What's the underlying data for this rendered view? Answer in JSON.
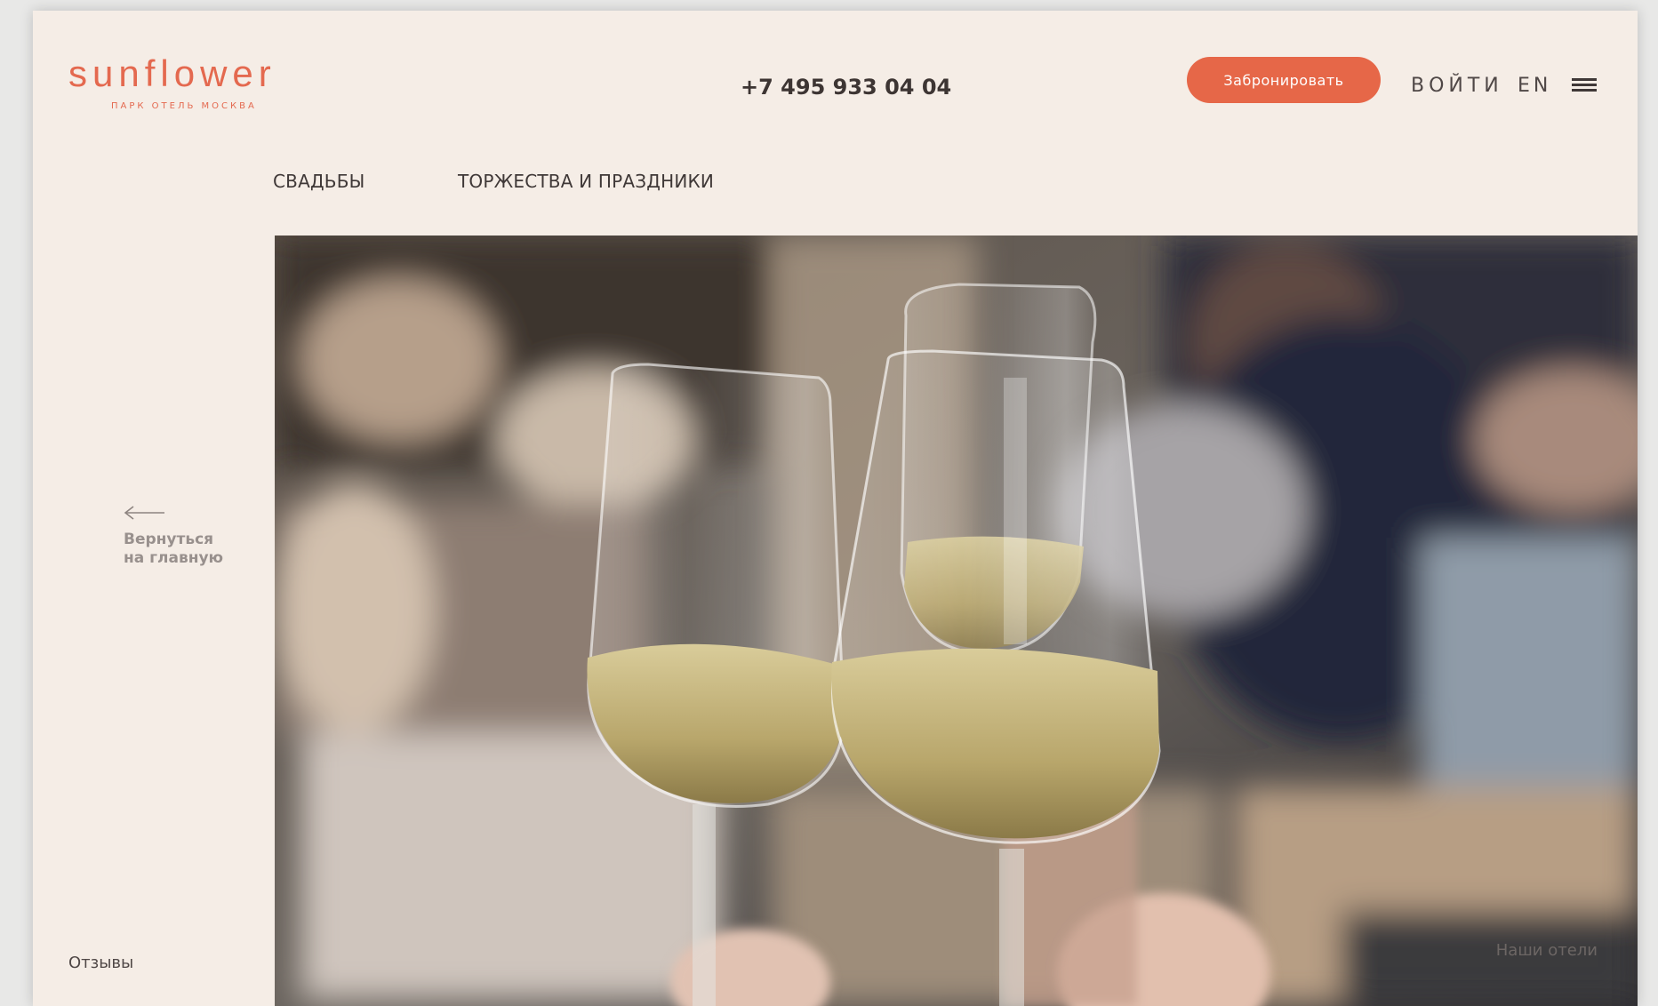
{
  "brand": {
    "logo_word": "sunflower",
    "logo_subtitle": "ПАРК ОТЕЛЬ МОСКВА"
  },
  "header": {
    "phone": "+7 495 933 04 04",
    "book_button": "Забронировать",
    "login": "ВОЙТИ",
    "language": "EN"
  },
  "subnav": {
    "items": [
      {
        "label": "СВАДЬБЫ"
      },
      {
        "label": "ТОРЖЕСТВА И ПРАЗДНИКИ"
      }
    ]
  },
  "sidebar": {
    "back_line1": "Вернуться",
    "back_line2": "на главную",
    "reviews": "Отзывы"
  },
  "hero": {
    "hotels_link": "Наши отели"
  },
  "colors": {
    "background": "#f5ede6",
    "accent": "#e66748",
    "text": "#3d3533",
    "muted_text": "#98908d"
  },
  "icons": {
    "menu": "hamburger-menu-icon",
    "back": "left-arrow-icon"
  }
}
